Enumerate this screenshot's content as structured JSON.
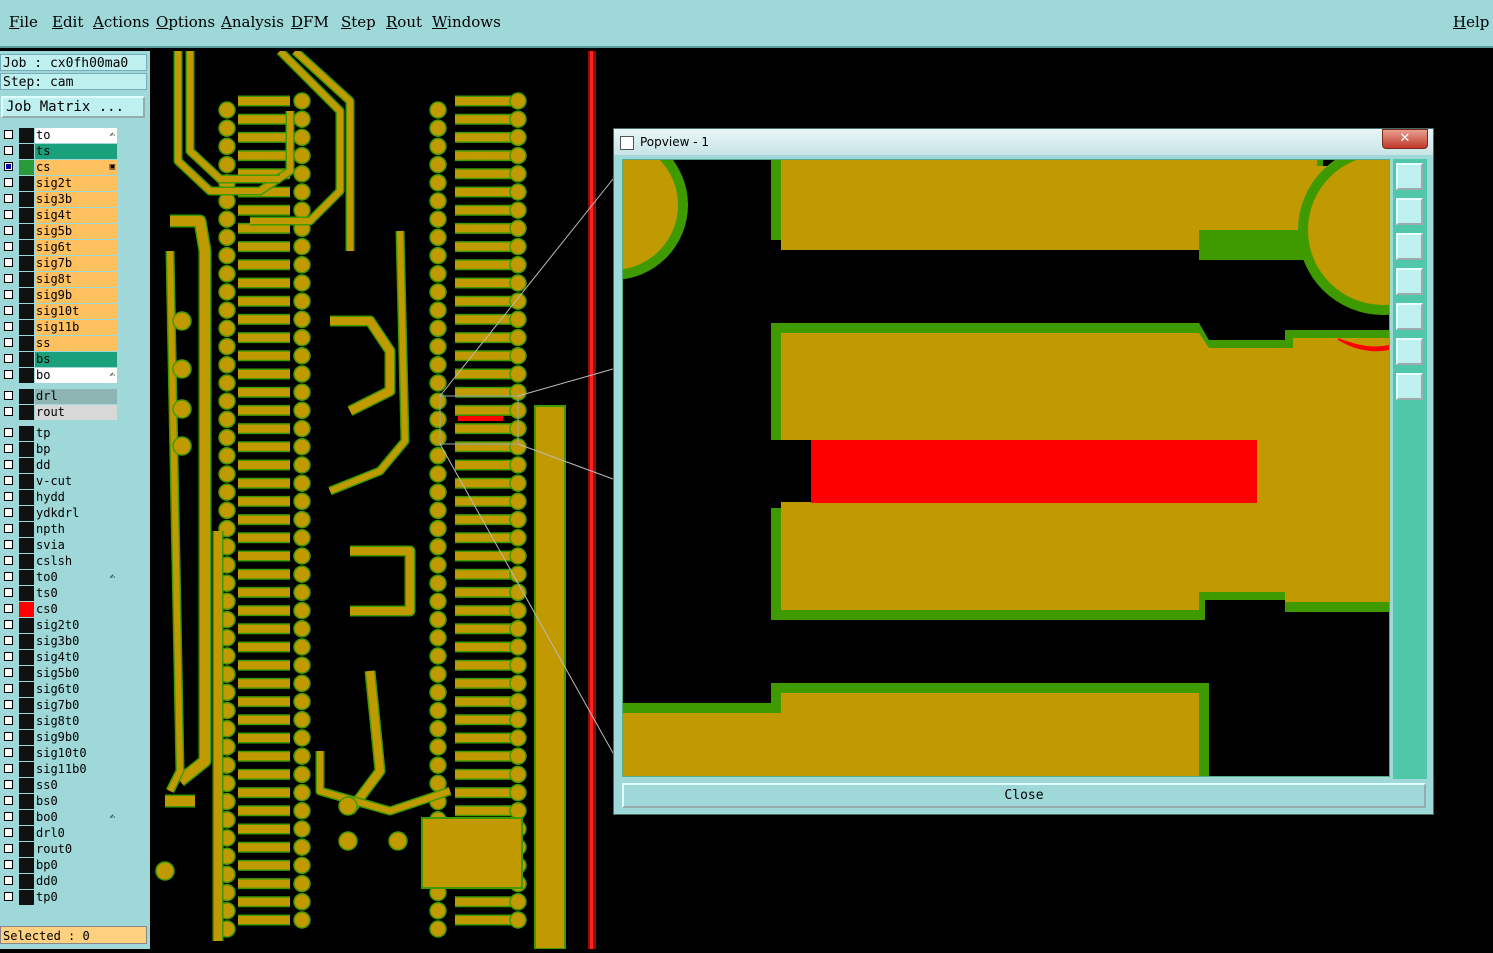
{
  "menu": {
    "items": [
      "File",
      "Edit",
      "Actions",
      "Options",
      "Analysis",
      "DFM",
      "Step",
      "Rout",
      "Windows"
    ],
    "help": "Help"
  },
  "info": {
    "job": "Job : cx0fh00ma0",
    "step": "Step: cam",
    "job_matrix": "Job Matrix ..."
  },
  "layers": [
    {
      "name": "to",
      "color": "#ffffff",
      "mark": "✍"
    },
    {
      "name": "ts",
      "color": "#1aa07a"
    },
    {
      "name": "cs",
      "color": "#ffc060",
      "mark": "▣",
      "checked": true
    },
    {
      "name": "sig2t",
      "color": "#ffc060"
    },
    {
      "name": "sig3b",
      "color": "#ffc060"
    },
    {
      "name": "sig4t",
      "color": "#ffc060"
    },
    {
      "name": "sig5b",
      "color": "#ffc060"
    },
    {
      "name": "sig6t",
      "color": "#ffc060"
    },
    {
      "name": "sig7b",
      "color": "#ffc060"
    },
    {
      "name": "sig8t",
      "color": "#ffc060"
    },
    {
      "name": "sig9b",
      "color": "#ffc060"
    },
    {
      "name": "sig10t",
      "color": "#ffc060"
    },
    {
      "name": "sig11b",
      "color": "#ffc060"
    },
    {
      "name": "ss",
      "color": "#ffc060"
    },
    {
      "name": "bs",
      "color": "#1aa07a"
    },
    {
      "name": "bo",
      "color": "#ffffff",
      "mark": "✍"
    },
    {
      "name": "drl",
      "color": "#8eb4b4",
      "gap": true
    },
    {
      "name": "rout",
      "color": "#d8d8d8"
    },
    {
      "name": "tp",
      "color": "#9ed8d8",
      "gap": true
    },
    {
      "name": "bp",
      "color": "#9ed8d8"
    },
    {
      "name": "dd",
      "color": "#9ed8d8"
    },
    {
      "name": "v-cut",
      "color": "#9ed8d8"
    },
    {
      "name": "hydd",
      "color": "#9ed8d8"
    },
    {
      "name": "ydkdrl",
      "color": "#9ed8d8"
    },
    {
      "name": "npth",
      "color": "#9ed8d8"
    },
    {
      "name": "svia",
      "color": "#9ed8d8"
    },
    {
      "name": "cslsh",
      "color": "#9ed8d8"
    },
    {
      "name": "to0",
      "color": "#9ed8d8",
      "mark": "✍"
    },
    {
      "name": "ts0",
      "color": "#9ed8d8"
    },
    {
      "name": "cs0",
      "color": "#9ed8d8",
      "swatch": "#ff0000"
    },
    {
      "name": "sig2t0",
      "color": "#9ed8d8"
    },
    {
      "name": "sig3b0",
      "color": "#9ed8d8"
    },
    {
      "name": "sig4t0",
      "color": "#9ed8d8"
    },
    {
      "name": "sig5b0",
      "color": "#9ed8d8"
    },
    {
      "name": "sig6t0",
      "color": "#9ed8d8"
    },
    {
      "name": "sig7b0",
      "color": "#9ed8d8"
    },
    {
      "name": "sig8t0",
      "color": "#9ed8d8"
    },
    {
      "name": "sig9b0",
      "color": "#9ed8d8"
    },
    {
      "name": "sig10t0",
      "color": "#9ed8d8"
    },
    {
      "name": "sig11b0",
      "color": "#9ed8d8"
    },
    {
      "name": "ss0",
      "color": "#9ed8d8"
    },
    {
      "name": "bs0",
      "color": "#9ed8d8"
    },
    {
      "name": "bo0",
      "color": "#9ed8d8",
      "mark": "✍"
    },
    {
      "name": "drl0",
      "color": "#9ed8d8"
    },
    {
      "name": "rout0",
      "color": "#9ed8d8"
    },
    {
      "name": "bp0",
      "color": "#9ed8d8"
    },
    {
      "name": "dd0",
      "color": "#9ed8d8"
    },
    {
      "name": "tp0",
      "color": "#9ed8d8"
    }
  ],
  "status": {
    "selected": "Selected : 0"
  },
  "popview": {
    "title": "Popview - 1",
    "close_x": "✕",
    "close_label": "Close",
    "tools": [
      "window-restore-icon",
      "zoom-up-icon",
      "zoom-down-icon",
      "pan-left-icon",
      "pan-right-icon",
      "fit-screen-icon",
      "center-icon"
    ]
  },
  "colors": {
    "copper": "#c09a00",
    "soldermask": "#3f9a00",
    "drill": "#ff0000",
    "bg": "#000000"
  }
}
